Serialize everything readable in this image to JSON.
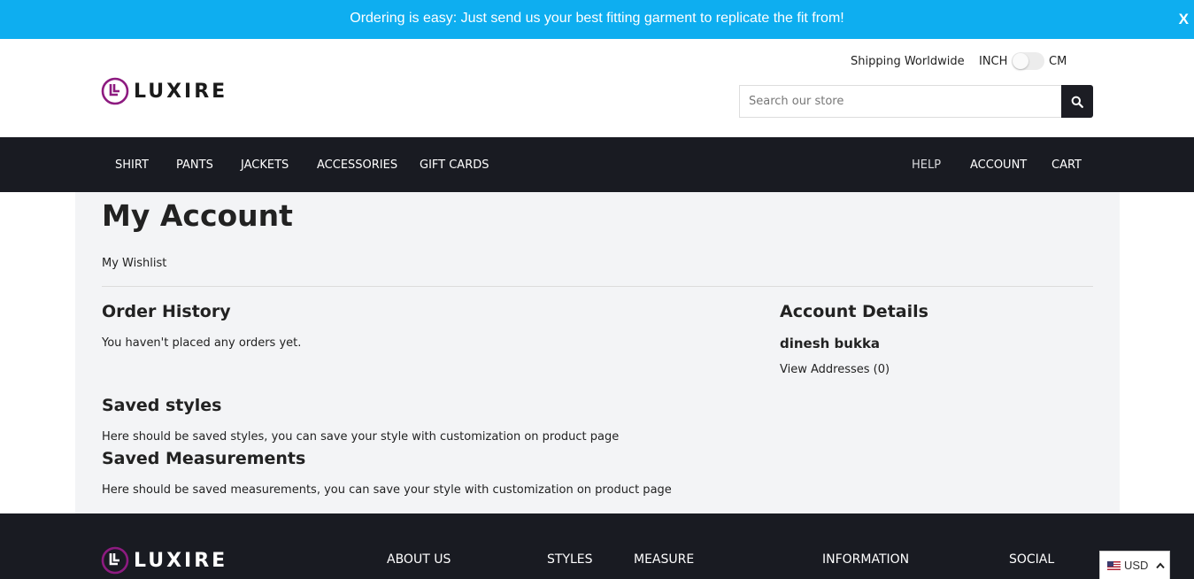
{
  "announcement": {
    "text": "Ordering is easy: Just send us your best fitting garment to replicate the fit from!",
    "close_label": "X",
    "color": "#0eaef0"
  },
  "brand": {
    "name": "LUXIRE",
    "logo_color": "#8d1b80"
  },
  "header": {
    "shipping": "Shipping Worldwide",
    "unit_left": "INCH",
    "unit_right": "CM",
    "search_placeholder": "Search our store",
    "search_icon": "search-icon"
  },
  "nav": {
    "left": [
      "SHIRT",
      "PANTS",
      "JACKETS",
      "ACCESSORIES",
      "GIFT CARDS"
    ],
    "right": [
      "HELP",
      "ACCOUNT",
      "CART"
    ]
  },
  "account": {
    "title": "My Account",
    "wishlist": "My Wishlist",
    "order_history": {
      "heading": "Order History",
      "text": "You haven't placed any orders yet."
    },
    "details": {
      "heading": "Account Details",
      "name": "dinesh bukka",
      "addresses_link": "View Addresses (0)"
    },
    "saved_styles": {
      "heading": "Saved styles",
      "text": "Here should be saved styles, you can save your style with customization on product page"
    },
    "saved_measurements": {
      "heading": "Saved Measurements",
      "text": "Here should be saved measurements, you can save your style with customization on product page"
    }
  },
  "footer": {
    "columns": [
      "ABOUT US",
      "STYLES",
      "MEASURE",
      "INFORMATION",
      "SOCIAL"
    ]
  },
  "currency": {
    "code": "USD",
    "flag_icon": "us-flag-icon",
    "chevron_icon": "chevron-up-icon"
  }
}
